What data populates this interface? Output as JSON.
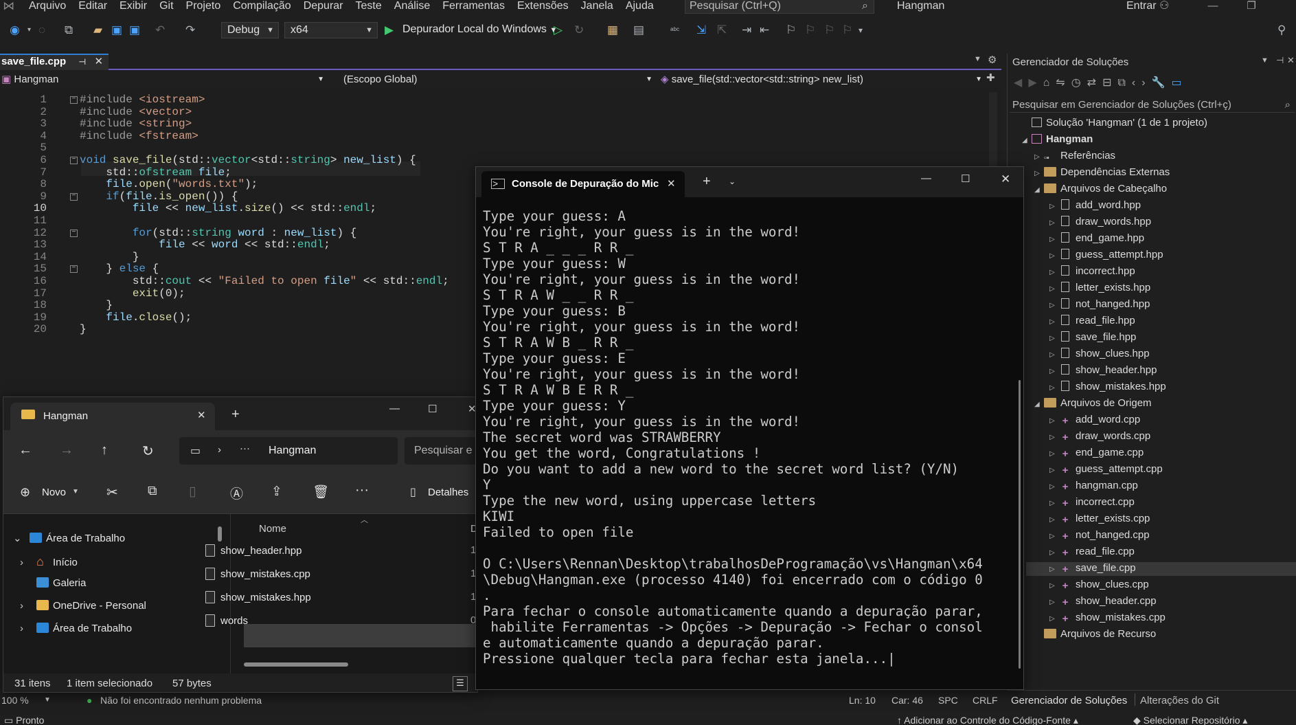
{
  "vs": {
    "menu": [
      "Arquivo",
      "Editar",
      "Exibir",
      "Git",
      "Projeto",
      "Compilação",
      "Depurar",
      "Teste",
      "Análise",
      "Ferramentas",
      "Extensões",
      "Janela",
      "Ajuda"
    ],
    "search_placeholder": "Pesquisar (Ctrl+Q)",
    "window_title": "Hangman",
    "login": "Entrar",
    "config": "Debug",
    "platform": "x64",
    "run_label": "Depurador Local do Windows",
    "editor_tab": "save_file.cpp",
    "nav_project": "Hangman",
    "nav_scope": "(Escopo Global)",
    "nav_member": "save_file(std::vector<std::string> new_list)",
    "status": {
      "zoom": "100 %",
      "issues": "Não foi encontrado nenhum problema",
      "ln": "Ln: 10",
      "car": "Car: 46",
      "spc": "SPC",
      "crlf": "CRLF",
      "ready": "Pronto",
      "add_source": "Adicionar ao Controle do Código-Fonte",
      "select_repo": "Selecionar Repositório"
    },
    "accent": "#6b5bbf"
  },
  "code_lines": [
    "#include <iostream>",
    "#include <vector>",
    "#include <string>",
    "#include <fstream>",
    "",
    "void save_file(std::vector<std::string> new_list) {",
    "    std::ofstream file;",
    "    file.open(\"words.txt\");",
    "    if(file.is_open()) {",
    "        file << new_list.size() << std::endl;",
    "",
    "        for(std::string word : new_list) {",
    "            file << word << std::endl;",
    "        }",
    "    } else {",
    "        std::cout << \"Failed to open file\" << std::endl;",
    "        exit(0);",
    "    }",
    "    file.close();",
    "}"
  ],
  "solution_explorer": {
    "title": "Gerenciador de Soluções",
    "search_placeholder": "Pesquisar em Gerenciador de Soluções (Ctrl+ç)",
    "solution": "Solução 'Hangman' (1 de 1 projeto)",
    "project": "Hangman",
    "references": "Referências",
    "external_deps": "Dependências Externas",
    "headers_folder": "Arquivos de Cabeçalho",
    "headers": [
      "add_word.hpp",
      "draw_words.hpp",
      "end_game.hpp",
      "guess_attempt.hpp",
      "incorrect.hpp",
      "letter_exists.hpp",
      "not_hanged.hpp",
      "read_file.hpp",
      "save_file.hpp",
      "show_clues.hpp",
      "show_header.hpp",
      "show_mistakes.hpp"
    ],
    "sources_folder": "Arquivos de Origem",
    "sources": [
      "add_word.cpp",
      "draw_words.cpp",
      "end_game.cpp",
      "guess_attempt.cpp",
      "hangman.cpp",
      "incorrect.cpp",
      "letter_exists.cpp",
      "not_hanged.cpp",
      "read_file.cpp",
      "save_file.cpp",
      "show_clues.cpp",
      "show_header.cpp",
      "show_mistakes.cpp"
    ],
    "resources_folder": "Arquivos de Recurso",
    "tab_active": "Gerenciador de Soluções",
    "tab_git": "Alterações do Git"
  },
  "console": {
    "tab_title": "Console de Depuração do Mic",
    "lines": [
      "Type your guess: A",
      "You're right, your guess is in the word!",
      "S T R A _ _ _ R R _",
      "Type your guess: W",
      "You're right, your guess is in the word!",
      "S T R A W _ _ R R _",
      "Type your guess: B",
      "You're right, your guess is in the word!",
      "S T R A W B _ R R _",
      "Type your guess: E",
      "You're right, your guess is in the word!",
      "S T R A W B E R R _",
      "Type your guess: Y",
      "You're right, your guess is in the word!",
      "The secret word was STRAWBERRY",
      "You get the word, Congratulations !",
      "Do you want to add a new word to the secret word list? (Y/N)",
      "Y",
      "Type the new word, using uppercase letters",
      "KIWI",
      "Failed to open file",
      "",
      "O C:\\Users\\Rennan\\Desktop\\trabalhosDeProgramação\\vs\\Hangman\\x64",
      "\\Debug\\Hangman.exe (processo 4140) foi encerrado com o código 0",
      ".",
      "Para fechar o console automaticamente quando a depuração parar,",
      " habilite Ferramentas -> Opções -> Depuração -> Fechar o consol",
      "e automaticamente quando a depuração parar.",
      "Pressione qualquer tecla para fechar esta janela...|"
    ]
  },
  "explorer": {
    "tab_title": "Hangman",
    "breadcrumb": "Hangman",
    "search_placeholder": "Pesquisar e",
    "new_button": "Novo",
    "details_button": "Detalhes",
    "column_name": "Nome",
    "column_next": "D",
    "nav": [
      "Área de Trabalho",
      "Início",
      "Galeria",
      "OneDrive - Personal",
      "Área de Trabalho"
    ],
    "files": [
      "show_header.hpp",
      "show_mistakes.cpp",
      "show_mistakes.hpp",
      "words"
    ],
    "file_tails": [
      "1",
      "1",
      "1",
      "0"
    ],
    "status_count": "31 itens",
    "status_selected": "1 item selecionado",
    "status_size": "57 bytes"
  }
}
